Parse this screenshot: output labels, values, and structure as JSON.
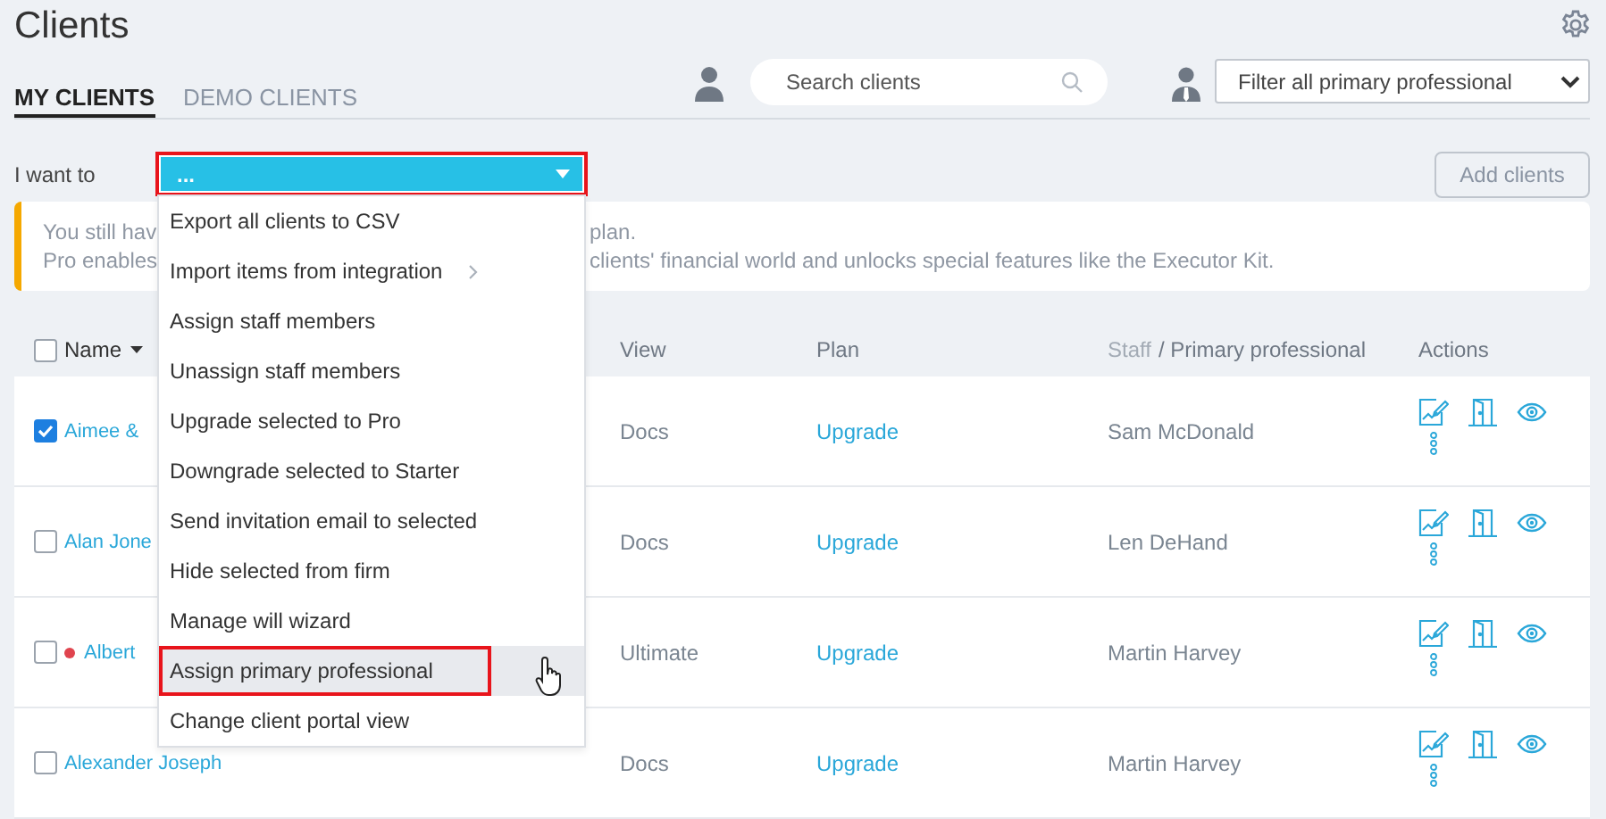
{
  "page": {
    "title": "Clients"
  },
  "tabs": [
    {
      "label": "MY CLIENTS",
      "selected": true
    },
    {
      "label": "DEMO CLIENTS",
      "selected": false
    }
  ],
  "search": {
    "placeholder": "Search clients"
  },
  "filter": {
    "value": "Filter all primary professional"
  },
  "action_bar": {
    "label": "I want to",
    "select": {
      "value": "...",
      "expanded": true,
      "annotated": true
    },
    "menu": [
      {
        "label": "Export all clients to CSV",
        "submenu": false,
        "hovered": false,
        "annotated": false
      },
      {
        "label": "Import items from integration",
        "submenu": true,
        "hovered": false,
        "annotated": false
      },
      {
        "label": "Assign staff members",
        "submenu": false,
        "hovered": false,
        "annotated": false
      },
      {
        "label": "Unassign staff members",
        "submenu": false,
        "hovered": false,
        "annotated": false
      },
      {
        "label": "Upgrade selected to Pro",
        "submenu": false,
        "hovered": false,
        "annotated": false
      },
      {
        "label": "Downgrade selected to Starter",
        "submenu": false,
        "hovered": false,
        "annotated": false
      },
      {
        "label": "Send invitation email to selected",
        "submenu": false,
        "hovered": false,
        "annotated": false
      },
      {
        "label": "Hide selected from firm",
        "submenu": false,
        "hovered": false,
        "annotated": false
      },
      {
        "label": "Manage will wizard",
        "submenu": false,
        "hovered": false,
        "annotated": false
      },
      {
        "label": "Assign primary professional",
        "submenu": false,
        "hovered": true,
        "annotated": true
      },
      {
        "label": "Change client portal view",
        "submenu": false,
        "hovered": false,
        "annotated": false
      }
    ],
    "add_button": "Add clients"
  },
  "banner": {
    "lines": [
      {
        "start": "You still hav",
        "end": "plan."
      },
      {
        "start": "Pro enables",
        "end": "clients' financial world and unlocks special features like the Executor Kit."
      }
    ]
  },
  "table": {
    "columns": {
      "select_all": false,
      "name": "Name",
      "view": "View",
      "plan": "Plan",
      "staff": "Staff",
      "primary": "/ Primary professional",
      "actions": "Actions"
    },
    "rows": [
      {
        "checked": true,
        "name": "Aimee &",
        "view": "Docs",
        "plan": "Upgrade",
        "professional": "Sam McDonald"
      },
      {
        "checked": false,
        "name": "Alan Jone",
        "view": "Docs",
        "plan": "Upgrade",
        "professional": "Len DeHand"
      },
      {
        "checked": false,
        "color": "#e0444e",
        "name": "Albert",
        "view": "Ultimate",
        "plan": "Upgrade",
        "professional": "Martin Harvey"
      },
      {
        "checked": false,
        "name": "Alexander Joseph",
        "view": "Docs",
        "plan": "Upgrade",
        "professional": "Martin Harvey"
      }
    ]
  }
}
